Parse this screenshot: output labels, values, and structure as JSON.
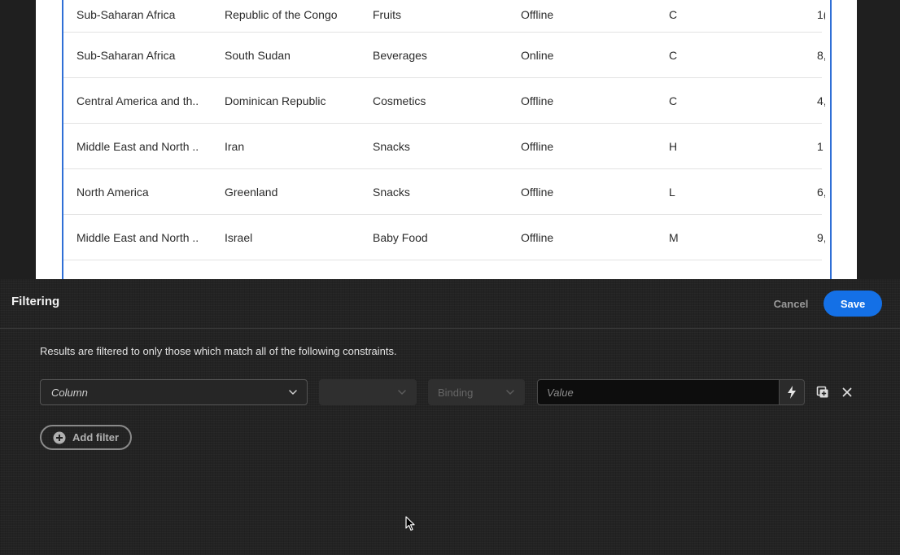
{
  "table": {
    "rows": [
      [
        "Sub-Saharan Africa",
        "Republic of the Congo",
        "Fruits",
        "Offline",
        "C",
        "1("
      ],
      [
        "Sub-Saharan Africa",
        "South Sudan",
        "Beverages",
        "Online",
        "C",
        "8,"
      ],
      [
        "Central America and th...",
        "Dominican Republic",
        "Cosmetics",
        "Offline",
        "C",
        "4,"
      ],
      [
        "Middle East and North ...",
        "Iran",
        "Snacks",
        "Offline",
        "H",
        "1"
      ],
      [
        "North America",
        "Greenland",
        "Snacks",
        "Offline",
        "L",
        "6,"
      ],
      [
        "Middle East and North ...",
        "Israel",
        "Baby Food",
        "Offline",
        "M",
        "9,"
      ],
      [
        "",
        "",
        "",
        "",
        "",
        ""
      ]
    ]
  },
  "filtering": {
    "title": "Filtering",
    "cancel_label": "Cancel",
    "save_label": "Save",
    "description": "Results are filtered to only those which match all of the following constraints.",
    "column_placeholder": "Column",
    "operator_value": "",
    "binding_label": "Binding",
    "value_placeholder": "Value",
    "add_filter_label": "Add filter"
  },
  "colors": {
    "accent": "#1470e6",
    "panel_background": "#232323",
    "table_focus_border": "#2f6fd6"
  },
  "icons": {
    "column_dropdown": "chevron-down-icon",
    "operator_dropdown": "chevron-down-icon",
    "binding_dropdown": "chevron-down-icon",
    "bolt": "lightning-bolt-icon",
    "duplicate": "duplicate-icon",
    "remove": "close-icon",
    "add": "plus-circle-icon",
    "cursor": "mouse-pointer-icon"
  }
}
